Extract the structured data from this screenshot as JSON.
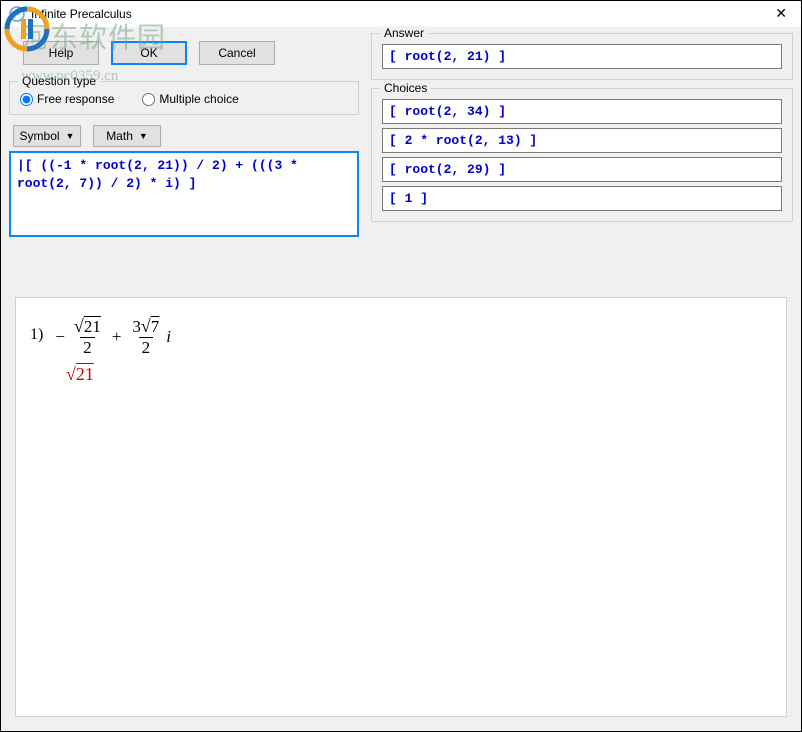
{
  "window": {
    "title": "Infinite Precalculus"
  },
  "buttons": {
    "help": "Help",
    "ok": "OK",
    "cancel": "Cancel"
  },
  "question_type": {
    "legend": "Question type",
    "free_response": "Free response",
    "multiple_choice": "Multiple choice"
  },
  "dropdowns": {
    "symbol": "Symbol",
    "math": "Math"
  },
  "expression": "|[ ((-1 * root(2, 21)) / 2) + (((3 * root(2, 7)) / 2) * i) ]",
  "answer": {
    "legend": "Answer",
    "value": "[ root(2, 21) ]"
  },
  "choices": {
    "legend": "Choices",
    "items": [
      "[ root(2, 34) ]",
      "[ 2 * root(2, 13) ]",
      "[ root(2, 29) ]",
      "[ 1 ]"
    ]
  },
  "preview": {
    "qnum": "1)",
    "neg": "−",
    "num1_sqrt": "21",
    "den1": "2",
    "plus": "+",
    "num2_coef": "3",
    "num2_sqrt": "7",
    "den2": "2",
    "i": "i",
    "answer_sqrt": "21"
  },
  "watermark": "河东软件园",
  "watermark_sub": "www.pc0359.cn"
}
